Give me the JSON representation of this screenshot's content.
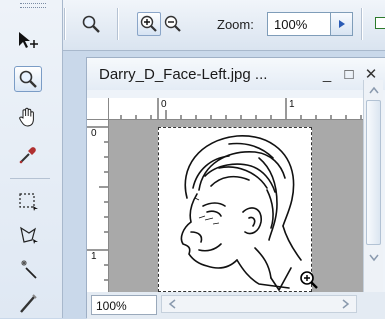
{
  "toolbox": {
    "tools": [
      {
        "name": "move-tool",
        "selected": false
      },
      {
        "name": "zoom-tool",
        "selected": true
      },
      {
        "name": "hand-tool",
        "selected": false
      },
      {
        "name": "eyedropper-tool",
        "selected": false
      },
      {
        "name": "rectangular-marquee-tool",
        "selected": false
      },
      {
        "name": "lasso-tool",
        "selected": false
      },
      {
        "name": "magic-wand-tool",
        "selected": false
      },
      {
        "name": "brush-tool",
        "selected": false
      }
    ]
  },
  "options_bar": {
    "zoom_label": "Zoom:",
    "zoom_value": "100%",
    "icons": [
      "zoom-tool-icon",
      "zoom-in-icon",
      "zoom-out-icon",
      "dropdown-arrow-icon"
    ]
  },
  "document": {
    "title": "Darry_D_Face-Left.jpg ...",
    "controls": {
      "minimize": "_",
      "maximize": "□",
      "close": "✕"
    },
    "ruler_h_labels": [
      "0",
      "1"
    ],
    "ruler_v_labels": [
      "0",
      "1"
    ],
    "zoom_status": "100%"
  }
}
